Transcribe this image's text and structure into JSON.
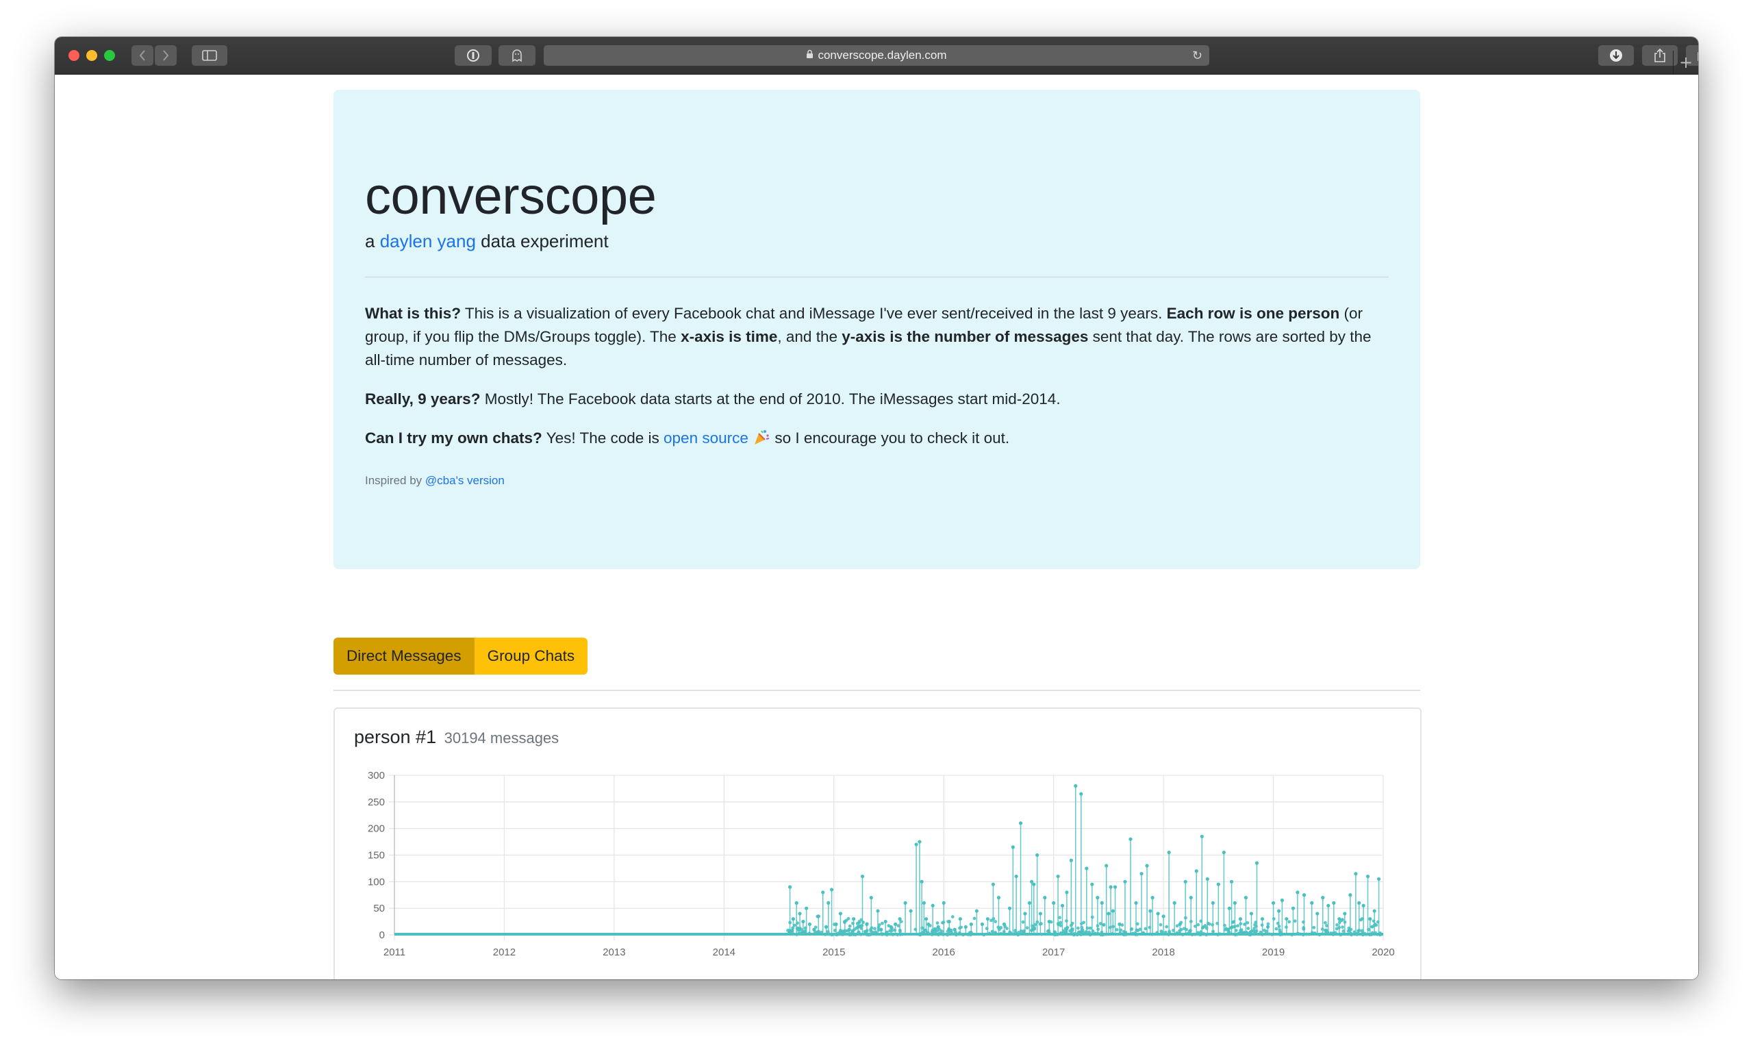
{
  "browser": {
    "url": "converscope.daylen.com",
    "back_icon": "chevron-left-icon",
    "forward_icon": "chevron-right-icon"
  },
  "header": {
    "title": "converscope",
    "subtitle_prefix": "a",
    "author_link": "daylen yang",
    "subtitle_suffix": "data experiment"
  },
  "intro": {
    "q1_label": "What is this?",
    "q1_text_a": " This is a visualization of every Facebook chat and iMessage I've ever sent/received in the last 9 years. ",
    "q1_bold_b": "Each row is one person",
    "q1_text_c": " (or group, if you flip the DMs/Groups toggle). The ",
    "q1_bold_d": "x-axis is time",
    "q1_text_e": ", and the ",
    "q1_bold_f": "y-axis is the number of messages",
    "q1_text_g": " sent that day. The rows are sorted by the all-time number of messages.",
    "q2_label": "Really, 9 years?",
    "q2_text": " Mostly! The Facebook data starts at the end of 2010. The iMessages start mid-2014.",
    "q3_label": "Can I try my own chats?",
    "q3_text_a": " Yes! The code is ",
    "q3_link": "open source",
    "q3_text_b": " so I encourage you to check it out.",
    "inspired_prefix": "Inspired by",
    "inspired_link": "@cba's version"
  },
  "toggle": {
    "direct": "Direct Messages",
    "groups": "Group Chats",
    "active": "direct"
  },
  "cards": [
    {
      "title": "person #1",
      "count": "30194 messages"
    }
  ],
  "chart_data": {
    "type": "line",
    "title": "",
    "xlabel": "",
    "ylabel": "",
    "x_ticks": [
      "2011",
      "2012",
      "2013",
      "2014",
      "2015",
      "2016",
      "2017",
      "2018",
      "2019",
      "2020"
    ],
    "y_ticks": [
      "0",
      "50",
      "100",
      "150",
      "200",
      "250",
      "300"
    ],
    "xlim": [
      2011.0,
      2020.0
    ],
    "ylim": [
      0,
      300
    ],
    "color": "#4bc0c0",
    "series": [
      {
        "x": [
          2014.6,
          2014.63,
          2014.66,
          2014.69,
          2014.72,
          2014.75,
          2014.78,
          2014.82,
          2014.86,
          2014.9,
          2014.93,
          2014.95,
          2014.98,
          2015.02,
          2015.06,
          2015.1,
          2015.14,
          2015.18,
          2015.22,
          2015.26,
          2015.3,
          2015.34,
          2015.4,
          2015.43,
          2015.47,
          2015.52,
          2015.56,
          2015.6,
          2015.65,
          2015.7,
          2015.75,
          2015.78,
          2015.8,
          2015.82,
          2015.84,
          2015.86,
          2015.9,
          2015.95,
          2016.0,
          2016.05,
          2016.1,
          2016.15,
          2016.2,
          2016.25,
          2016.3,
          2016.35,
          2016.4,
          2016.45,
          2016.5,
          2016.55,
          2016.6,
          2016.63,
          2016.66,
          2016.7,
          2016.74,
          2016.78,
          2016.8,
          2016.82,
          2016.85,
          2016.88,
          2016.92,
          2016.96,
          2017.0,
          2017.04,
          2017.08,
          2017.12,
          2017.16,
          2017.2,
          2017.25,
          2017.3,
          2017.35,
          2017.4,
          2017.44,
          2017.48,
          2017.5,
          2017.52,
          2017.54,
          2017.56,
          2017.6,
          2017.65,
          2017.7,
          2017.75,
          2017.8,
          2017.85,
          2017.88,
          2017.9,
          2017.95,
          2018.0,
          2018.05,
          2018.1,
          2018.15,
          2018.2,
          2018.25,
          2018.3,
          2018.35,
          2018.4,
          2018.45,
          2018.5,
          2018.55,
          2018.6,
          2018.62,
          2018.65,
          2018.7,
          2018.75,
          2018.8,
          2018.85,
          2018.9,
          2018.95,
          2019.0,
          2019.05,
          2019.08,
          2019.12,
          2019.18,
          2019.22,
          2019.28,
          2019.35,
          2019.4,
          2019.45,
          2019.5,
          2019.55,
          2019.6,
          2019.65,
          2019.7,
          2019.75,
          2019.78,
          2019.82,
          2019.86,
          2019.88,
          2019.92,
          2019.96
        ],
        "y": [
          90,
          30,
          60,
          40,
          25,
          50,
          20,
          10,
          35,
          80,
          15,
          60,
          85,
          20,
          40,
          25,
          10,
          30,
          15,
          110,
          20,
          70,
          45,
          10,
          25,
          15,
          20,
          30,
          60,
          45,
          170,
          175,
          100,
          60,
          30,
          20,
          55,
          15,
          60,
          25,
          10,
          30,
          15,
          20,
          45,
          20,
          30,
          95,
          70,
          20,
          50,
          165,
          110,
          210,
          40,
          60,
          100,
          95,
          150,
          40,
          70,
          25,
          60,
          110,
          55,
          80,
          140,
          280,
          265,
          125,
          95,
          70,
          60,
          130,
          40,
          90,
          45,
          90,
          20,
          100,
          180,
          60,
          115,
          130,
          45,
          70,
          40,
          35,
          155,
          60,
          20,
          100,
          70,
          120,
          185,
          105,
          60,
          95,
          155,
          50,
          100,
          60,
          30,
          70,
          40,
          135,
          30,
          15,
          60,
          45,
          65,
          30,
          50,
          80,
          75,
          60,
          40,
          70,
          55,
          60,
          30,
          40,
          75,
          115,
          60,
          55,
          110,
          30,
          45,
          105
        ]
      }
    ]
  }
}
